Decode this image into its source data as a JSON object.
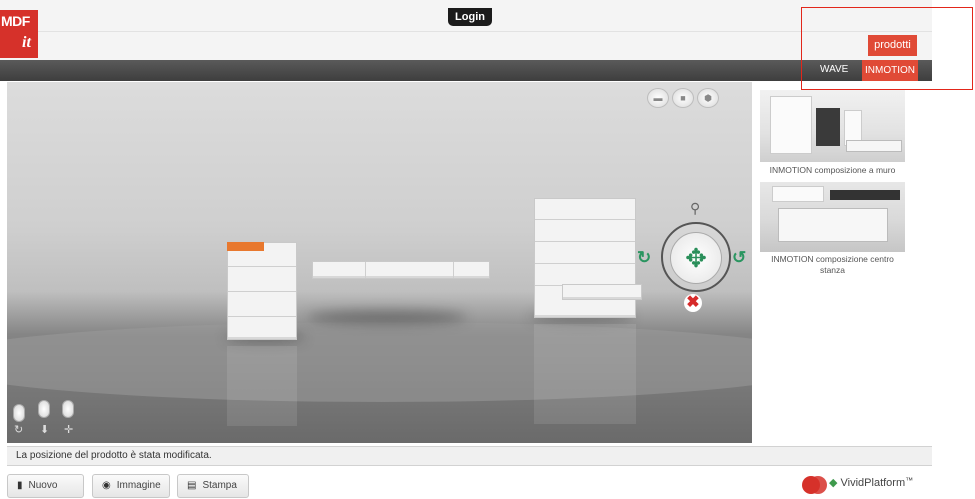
{
  "header": {
    "logo_top": "MDF",
    "logo_italic": "it",
    "login_label": "Login",
    "prodotti_label": "prodotti"
  },
  "categories": {
    "items": [
      {
        "label": "WAVE",
        "active": false
      },
      {
        "label": "INMOTION",
        "active": true
      }
    ]
  },
  "sidebar": {
    "items": [
      {
        "caption": "INMOTION composizione a muro"
      },
      {
        "caption": "INMOTION composizione centro stanza"
      }
    ]
  },
  "viewport": {
    "view_buttons": [
      "view-mode-icon",
      "view-mode-icon",
      "view-mode-icon"
    ]
  },
  "status": {
    "message": "La posizione del prodotto è stata modificata."
  },
  "toolbar": {
    "nuovo_label": "Nuovo",
    "immagine_label": "Immagine",
    "stampa_label": "Stampa"
  },
  "brand": {
    "name": "VividPlatform",
    "tm": "™"
  },
  "colors": {
    "accent": "#e04a36",
    "gizmo": "#2a8f5a",
    "delete": "#d62a2a"
  }
}
